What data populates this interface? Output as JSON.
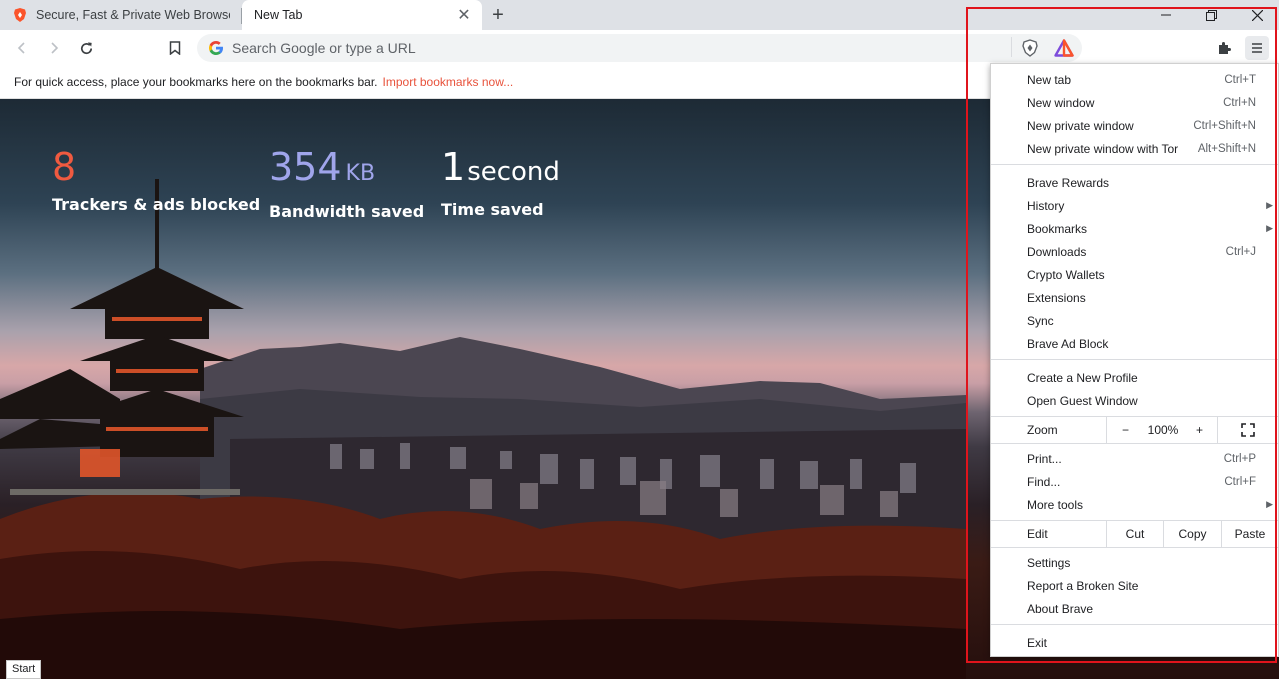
{
  "tabs": [
    {
      "title": "Secure, Fast & Private Web Browser wi",
      "active": false
    },
    {
      "title": "New Tab",
      "active": true
    }
  ],
  "window": {
    "minimize_glyph": "—",
    "restore_glyph": "❐",
    "close_glyph": "✕",
    "new_tab_glyph": "+"
  },
  "toolbar": {
    "search_placeholder": "Search Google or type a URL",
    "back_icon": "arrow-left-icon",
    "forward_icon": "arrow-right-icon",
    "reload_icon": "reload-icon",
    "bookmark_icon": "bookmark-icon"
  },
  "bookmarks_bar": {
    "message": "For quick access, place your bookmarks here on the bookmarks bar.",
    "link": "Import bookmarks now..."
  },
  "stats": {
    "trackers": {
      "value": "8",
      "label": "Trackers & ads blocked",
      "color": "#f05a40"
    },
    "bandwidth": {
      "value": "354",
      "unit": "KB",
      "label": "Bandwidth saved",
      "color": "#a0a5eb"
    },
    "time": {
      "value": "1",
      "unit": "second",
      "label": "Time saved",
      "color": "#ffffff"
    }
  },
  "status_bar": {
    "text": "Start"
  },
  "menu": {
    "group1": [
      {
        "label": "New tab",
        "accel": "Ctrl+T"
      },
      {
        "label": "New window",
        "accel": "Ctrl+N"
      },
      {
        "label": "New private window",
        "accel": "Ctrl+Shift+N"
      },
      {
        "label": "New private window with Tor",
        "accel": "Alt+Shift+N"
      }
    ],
    "group2": [
      {
        "label": "Brave Rewards",
        "accel": ""
      },
      {
        "label": "History",
        "accel": "",
        "submenu": true
      },
      {
        "label": "Bookmarks",
        "accel": "",
        "submenu": true
      },
      {
        "label": "Downloads",
        "accel": "Ctrl+J"
      },
      {
        "label": "Crypto Wallets",
        "accel": ""
      },
      {
        "label": "Extensions",
        "accel": ""
      },
      {
        "label": "Sync",
        "accel": ""
      },
      {
        "label": "Brave Ad Block",
        "accel": ""
      }
    ],
    "group3": [
      {
        "label": "Create a New Profile",
        "accel": ""
      },
      {
        "label": "Open Guest Window",
        "accel": ""
      }
    ],
    "zoom": {
      "label": "Zoom",
      "minus": "−",
      "value": "100%",
      "plus": "+"
    },
    "group4": [
      {
        "label": "Print...",
        "accel": "Ctrl+P"
      },
      {
        "label": "Find...",
        "accel": "Ctrl+F"
      },
      {
        "label": "More tools",
        "accel": "",
        "submenu": true
      }
    ],
    "edit": {
      "label": "Edit",
      "cut": "Cut",
      "copy": "Copy",
      "paste": "Paste"
    },
    "group5": [
      {
        "label": "Settings",
        "accel": ""
      },
      {
        "label": "Report a Broken Site",
        "accel": ""
      },
      {
        "label": "About Brave",
        "accel": ""
      }
    ],
    "exit": {
      "label": "Exit"
    }
  },
  "colors": {
    "highlight_box": "#e0141c",
    "brave_orange": "#fb542b",
    "link": "#e8523b"
  }
}
